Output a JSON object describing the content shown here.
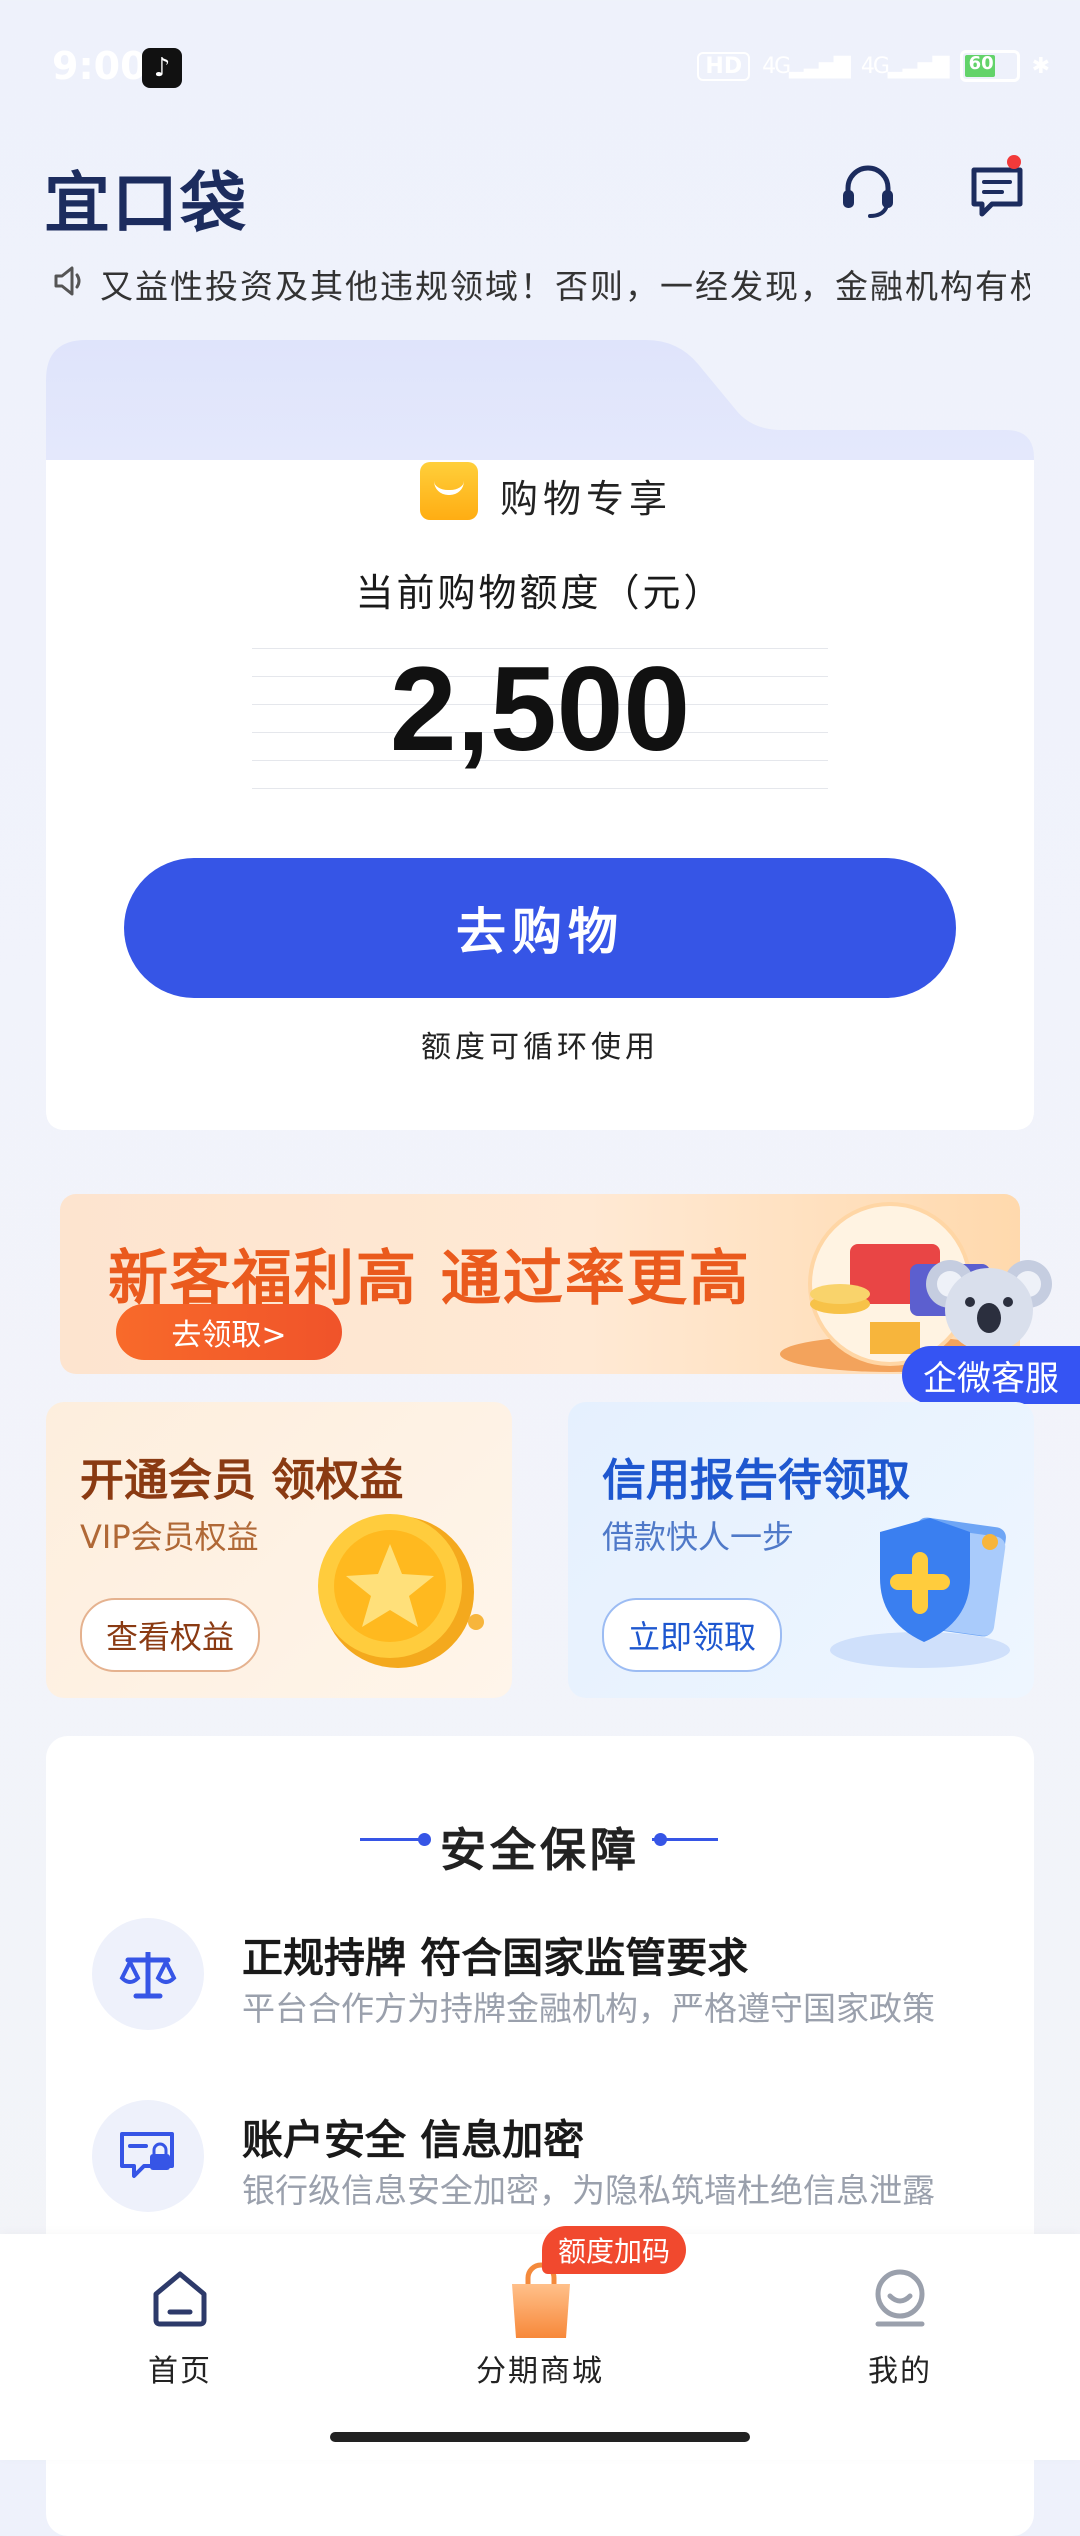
{
  "status_bar": {
    "time": "9:00",
    "network": "HD",
    "signal1": "4G",
    "signal2": "4G",
    "battery": "60"
  },
  "header": {
    "logo": "宜口袋"
  },
  "notice": {
    "text": "又益性投资及其他违规领域！否则，一经发现，金融机构有权停."
  },
  "main_card": {
    "subtitle": "购物专享",
    "limit_label": "当前购物额度（元）",
    "limit_amount": "2,500",
    "button": "去购物",
    "note": "额度可循环使用"
  },
  "promo": {
    "title": "新客福利高 通过率更高",
    "button": "去领取>"
  },
  "customer_service": {
    "label": "企微客服"
  },
  "features": {
    "vip": {
      "title": "开通会员 领权益",
      "subtitle": "VIP会员权益",
      "button": "查看权益"
    },
    "credit": {
      "title": "信用报告待领取",
      "subtitle": "借款快人一步",
      "button": "立即领取"
    }
  },
  "safety": {
    "title": "安全保障",
    "items": [
      {
        "title": "正规持牌 符合国家监管要求",
        "desc": "平台合作方为持牌金融机构，严格遵守国家政策"
      },
      {
        "title": "账户安全 信息加密",
        "desc": "银行级信息安全加密，为隐私筑墙杜绝信息泄露"
      }
    ]
  },
  "tabbar": {
    "items": [
      {
        "label": "首页"
      },
      {
        "label": "分期商城"
      },
      {
        "label": "我的"
      }
    ],
    "badge": "额度加码"
  }
}
